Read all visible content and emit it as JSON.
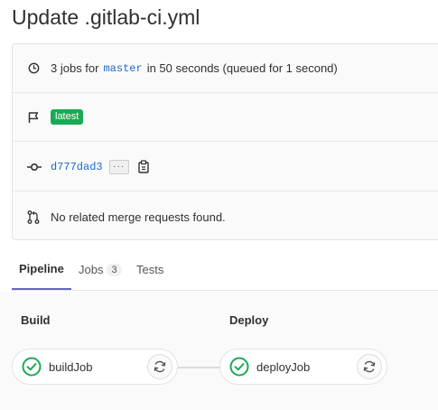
{
  "page": {
    "title": "Update .gitlab-ci.yml"
  },
  "info": {
    "jobs_text": "3 jobs for",
    "branch": "master",
    "duration_text": "in 50 seconds (queued for 1 second)",
    "tag_label": "latest",
    "commit_sha": "d777dad3",
    "ellipsis_label": "···",
    "merge_requests_text": "No related merge requests found."
  },
  "tabs": [
    {
      "label": "Pipeline",
      "active": true
    },
    {
      "label": "Jobs",
      "count": "3",
      "active": false
    },
    {
      "label": "Tests",
      "active": false
    }
  ],
  "stages": [
    {
      "title": "Build",
      "jobs": [
        {
          "name": "buildJob",
          "status": "passed"
        }
      ]
    },
    {
      "title": "Deploy",
      "jobs": [
        {
          "name": "deployJob",
          "status": "passed"
        }
      ]
    }
  ],
  "colors": {
    "success": "#1aaa55",
    "link": "#1f69c9",
    "tab_active_underline": "#6666c4"
  },
  "icons": {
    "clock": "clock-icon",
    "flag": "flag-icon",
    "commit": "commit-icon",
    "copy": "clipboard-icon",
    "merge_request": "merge-request-icon",
    "status": "status-success-icon",
    "retry": "retry-icon"
  }
}
